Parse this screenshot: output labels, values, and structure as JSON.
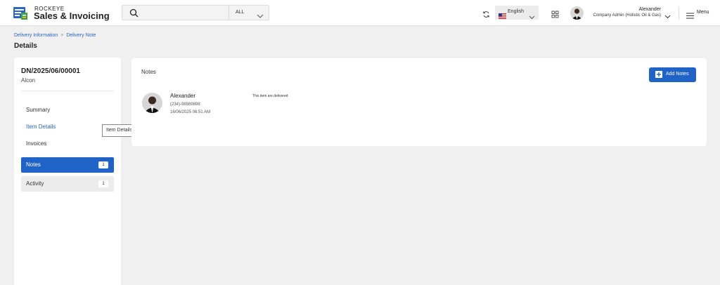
{
  "app": {
    "brand_top": "ROCKEYE",
    "brand_main": "Sales & Invoicing"
  },
  "search": {
    "placeholder": "",
    "filter": "ALL"
  },
  "header": {
    "language": "English",
    "user_name": "Alexander",
    "user_role": "Company Admin (Holistic Oil & Gas)",
    "menu_label": "Menu"
  },
  "breadcrumb": {
    "items": [
      "Delivery Information",
      "Delivery Note"
    ]
  },
  "page": {
    "title": "Details"
  },
  "document": {
    "number": "DN/2025/06/00001",
    "customer": "Alcon"
  },
  "nav": {
    "items": [
      {
        "label": "Summary"
      },
      {
        "label": "Item Details"
      },
      {
        "label": "Invoices"
      },
      {
        "label": "Notes",
        "badge": "1"
      },
      {
        "label": "Activity",
        "badge": "1"
      }
    ]
  },
  "tooltip": {
    "text": "Item Details"
  },
  "notes": {
    "title": "Notes",
    "add_label": "Add Notes",
    "entries": [
      {
        "author": "Alexander",
        "phone": "(234)-98989898",
        "time": "16/06/2025 06:51 AM",
        "text": "This item are delivered"
      }
    ]
  },
  "colors": {
    "accent": "#1f63c6",
    "link": "#2a66c4",
    "background": "#f0f0f0"
  },
  "icons": [
    "app-logo-icon",
    "search-icon",
    "chevron-down-icon",
    "refresh-icon",
    "us-flag-icon",
    "apps-grid-icon",
    "hamburger-menu-icon",
    "plus-icon"
  ]
}
